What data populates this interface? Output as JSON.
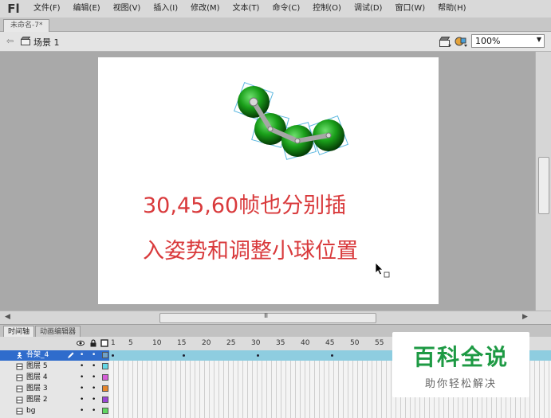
{
  "app": {
    "logo": "Fl"
  },
  "menu": [
    "文件(F)",
    "编辑(E)",
    "视图(V)",
    "插入(I)",
    "修改(M)",
    "文本(T)",
    "命令(C)",
    "控制(O)",
    "调试(D)",
    "窗口(W)",
    "帮助(H)"
  ],
  "document_tab": "未命名-7*",
  "editbar": {
    "back_icon": "arrow-left-icon",
    "scene_label": "场景 1",
    "zoom_value": "100%"
  },
  "stage": {
    "overlay_text": "30,45,60帧也分别插入姿势和调整小球位置",
    "ball_color": "#1aa01a",
    "text_color": "#d93a3c"
  },
  "hscroll_grip": "III",
  "panel_tabs": [
    "时间轴",
    "动画编辑器"
  ],
  "timeline": {
    "frame_numbers": [
      "1",
      "5",
      "10",
      "15",
      "20",
      "25",
      "30",
      "35",
      "40",
      "45",
      "50",
      "55"
    ],
    "layers": [
      {
        "name": "骨架_4",
        "selected": true,
        "color": "#6fa0c8",
        "vis": "•",
        "lock": "•"
      },
      {
        "name": "图层 5",
        "selected": false,
        "color": "#64d6e6",
        "vis": "•",
        "lock": "•"
      },
      {
        "name": "图层 4",
        "selected": false,
        "color": "#d65fd8",
        "vis": "•",
        "lock": "•"
      },
      {
        "name": "图层 3",
        "selected": false,
        "color": "#e6862c",
        "vis": "•",
        "lock": "•"
      },
      {
        "name": "图层 2",
        "selected": false,
        "color": "#9a46d6",
        "vis": "•",
        "lock": "•"
      },
      {
        "name": "bg",
        "selected": false,
        "color": "#5fd65f",
        "vis": "•",
        "lock": "•"
      }
    ]
  },
  "watermark": {
    "title": "百科全说",
    "subtitle": "助你轻松解决"
  }
}
